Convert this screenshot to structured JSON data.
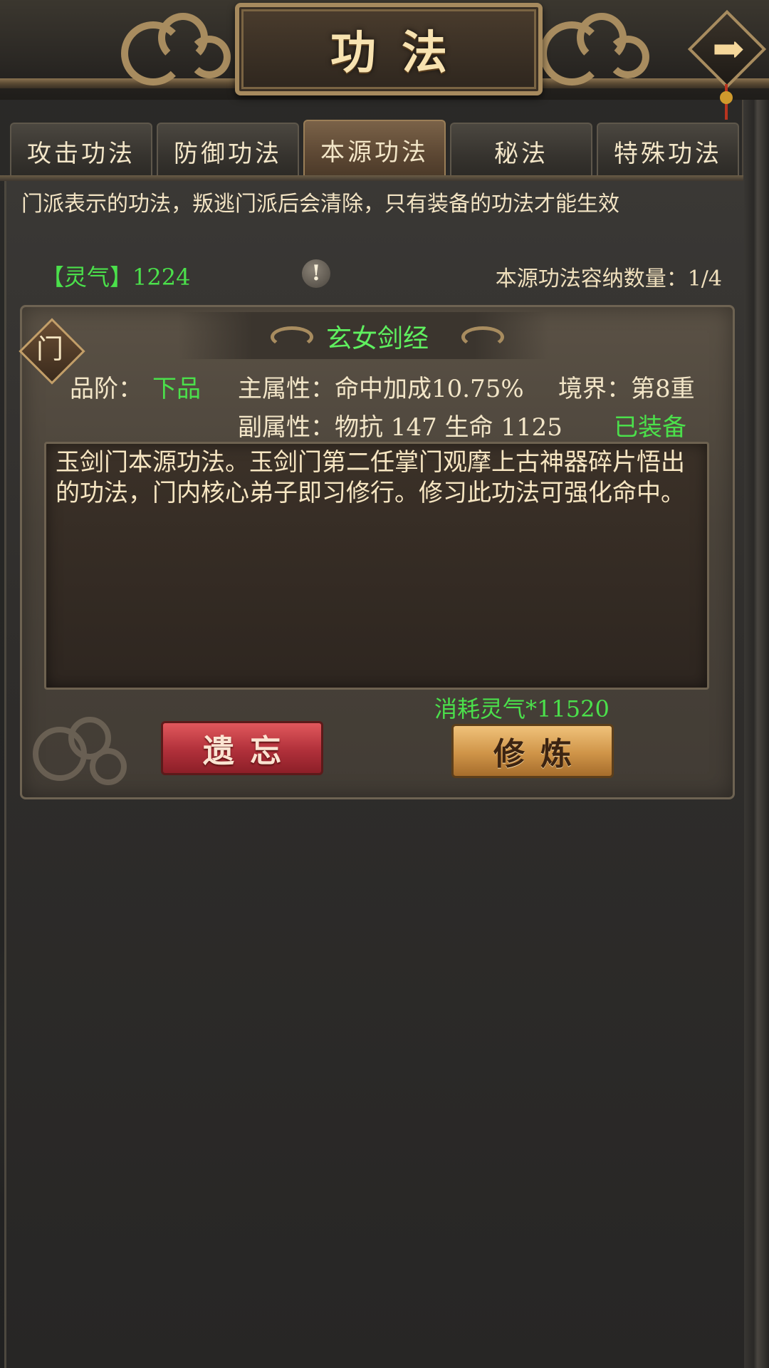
{
  "header": {
    "title": "功法"
  },
  "tabs": [
    {
      "label": "攻击功法"
    },
    {
      "label": "防御功法"
    },
    {
      "label": "本源功法",
      "active": true
    },
    {
      "label": "秘法"
    },
    {
      "label": "特殊功法"
    }
  ],
  "notice": "门派表示的功法，叛逃门派后会清除，只有装备的功法才能生效",
  "resources": {
    "lingqi": "【灵气】1224",
    "info_icon": "!",
    "capacity": "本源功法容纳数量：1/4"
  },
  "card": {
    "sect_badge": "门",
    "name": "玄女剑经",
    "grade_label": "品阶：",
    "grade_value": "下品",
    "main_attr": "主属性：命中加成10.75%",
    "realm": "境界：第8重",
    "sub_attr": "副属性：物抗 147 生命 1125",
    "status": "已装备",
    "description": "玉剑门本源功法。玉剑门第二任掌门观摩上古神器碎片悟出的功法，门内核心弟子即习修行。修习此功法可强化命中。",
    "cost": "消耗灵气*11520",
    "forget_label": "遗忘",
    "train_label": "修炼"
  },
  "colors": {
    "accent_green": "#4be04b",
    "gold": "#a88c5f",
    "forget_red": "#c03a42",
    "train_gold": "#d9a052"
  },
  "icons": {
    "next": "arrow-right-icon",
    "info": "exclamation-icon",
    "sect": "sect-diamond-icon"
  }
}
